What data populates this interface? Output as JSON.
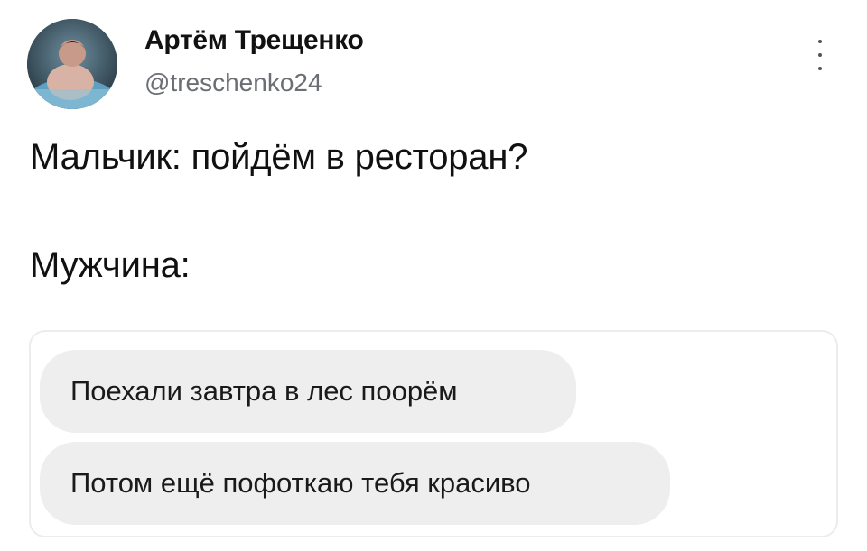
{
  "post": {
    "author_name": "Артём Трещенко",
    "author_handle": "@treschenko24",
    "text_line_1": "Мальчик: пойдём в ресторан?",
    "text_line_2": "Мужчина:"
  },
  "chat": {
    "messages": [
      "Поехали завтра в лес поорём",
      "Потом ещё пофоткаю тебя красиво"
    ]
  },
  "icons": {
    "avatar": "profile-photo",
    "more": "vertical-ellipsis-icon"
  }
}
